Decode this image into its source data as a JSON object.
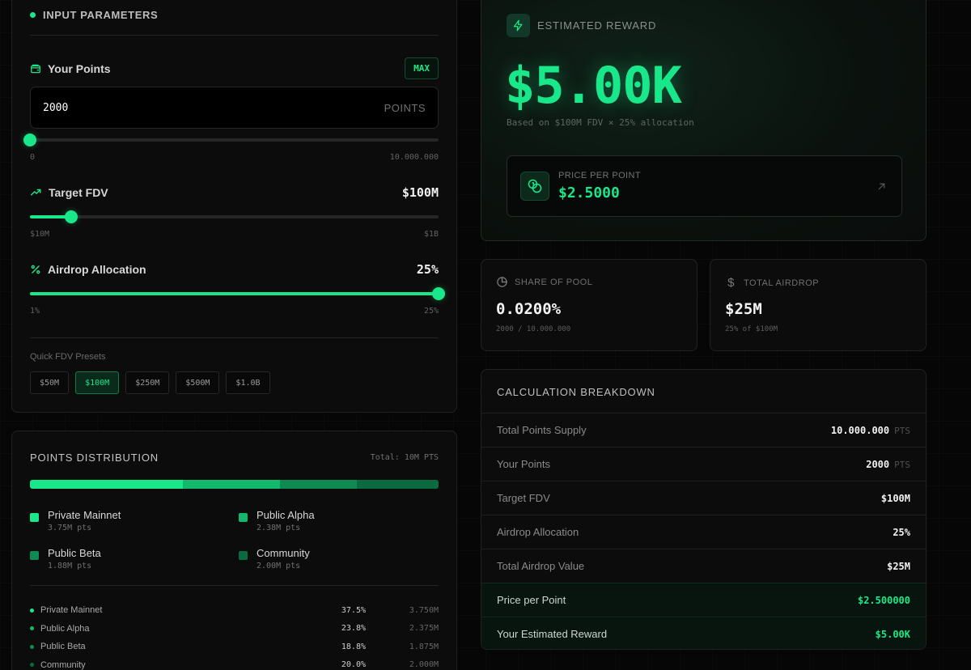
{
  "inputs": {
    "title": "INPUT PARAMETERS",
    "your_points": {
      "label": "Your Points",
      "max_label": "MAX",
      "value": "2000",
      "unit": "POINTS",
      "slider_fraction": 0.0002,
      "range_min": "0",
      "range_max": "10.000.000"
    },
    "target_fdv": {
      "label": "Target FDV",
      "value": "$100M",
      "slider_fraction": 0.1,
      "range_min": "$10M",
      "range_max": "$1B"
    },
    "airdrop_allocation": {
      "label": "Airdrop Allocation",
      "value": "25%",
      "slider_fraction": 1.0,
      "range_min": "1%",
      "range_max": "25%"
    },
    "presets_label": "Quick FDV Presets",
    "presets": [
      "$50M",
      "$100M",
      "$250M",
      "$500M",
      "$1.0B"
    ],
    "active_preset": "$100M"
  },
  "distribution": {
    "title": "POINTS DISTRIBUTION",
    "total": "Total: 10M PTS",
    "segments": [
      {
        "name": "Private Mainnet",
        "amount": "3.75M pts",
        "pct": "37.5%",
        "value": "3.750M",
        "share": 37.5,
        "color": "#19e88a"
      },
      {
        "name": "Public Alpha",
        "amount": "2.38M pts",
        "pct": "23.8%",
        "value": "2.375M",
        "share": 23.75,
        "color": "#14b86d"
      },
      {
        "name": "Public Beta",
        "amount": "1.88M pts",
        "pct": "18.8%",
        "value": "1.875M",
        "share": 18.75,
        "color": "#0f8a52"
      },
      {
        "name": "Community",
        "amount": "2.00M pts",
        "pct": "20.0%",
        "value": "2.000M",
        "share": 20.0,
        "color": "#0b6a40"
      }
    ]
  },
  "reward": {
    "label": "ESTIMATED REWARD",
    "value": "$5.00K",
    "subtitle": "Based on $100M FDV × 25% allocation",
    "ppp_label": "PRICE PER POINT",
    "ppp_value": "$2.5000"
  },
  "share": {
    "label": "SHARE OF POOL",
    "value": "0.0200%",
    "sub": "2000 / 10.000.000"
  },
  "total_airdrop": {
    "label": "TOTAL AIRDROP",
    "value": "$25M",
    "sub": "25% of $100M"
  },
  "calc": {
    "title": "CALCULATION BREAKDOWN",
    "rows": [
      {
        "name": "Total Points Supply",
        "value": "10.000.000",
        "unit": "PTS"
      },
      {
        "name": "Your Points",
        "value": "2000",
        "unit": "PTS"
      },
      {
        "name": "Target FDV",
        "value": "$100M",
        "unit": ""
      },
      {
        "name": "Airdrop Allocation",
        "value": "25%",
        "unit": ""
      },
      {
        "name": "Total Airdrop Value",
        "value": "$25M",
        "unit": ""
      },
      {
        "name": "Price per Point",
        "value": "$2.500000",
        "unit": ""
      },
      {
        "name": "Your Estimated Reward",
        "value": "$5.00K",
        "unit": ""
      }
    ]
  },
  "colors": {
    "accent": "#19e88a",
    "background": "#060606",
    "card": "#0c0c0c"
  }
}
